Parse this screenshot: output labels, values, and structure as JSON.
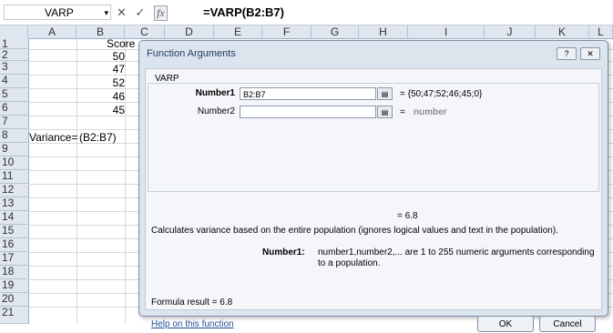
{
  "formula_bar": {
    "name_box": "VARP",
    "name_box_dropdown": "▾",
    "cancel_glyph": "✕",
    "enter_glyph": "✓",
    "fx_label": "fx",
    "formula": "=VARP(B2:B7)"
  },
  "columns": [
    "A",
    "B",
    "C",
    "D",
    "E",
    "F",
    "G",
    "H",
    "I",
    "J",
    "K",
    "L"
  ],
  "rows": [
    "1",
    "2",
    "3",
    "4",
    "5",
    "6",
    "7",
    "8",
    "9",
    "10",
    "11",
    "12",
    "13",
    "14",
    "15",
    "16",
    "17",
    "18",
    "19",
    "20",
    "21"
  ],
  "cells": {
    "B1": "Score",
    "B2": "50",
    "B3": "47",
    "B4": "52",
    "B5": "46",
    "B6": "45",
    "A8": "Variance=",
    "B8": "(B2:B7)"
  },
  "dialog": {
    "title": "Function Arguments",
    "help_glyph": "?",
    "close_glyph": "✕",
    "function_name": "VARP",
    "arg1_label": "Number1",
    "arg1_value": "B2:B7",
    "arg1_eval": "=  {50;47;52;46;45;0}",
    "arg2_label": "Number2",
    "arg2_value": "",
    "arg2_eval_eq": "=",
    "arg2_eval": "number",
    "ref_glyph": "▤",
    "function_result": "=  6.8",
    "description": "Calculates variance based on the entire population (ignores logical values and text in the population).",
    "arg_desc_name": "Number1:",
    "arg_desc_text": "number1,number2,... are 1 to 255 numeric arguments corresponding to a population.",
    "formula_result": "Formula result =  6.8",
    "help_link": "Help on this function",
    "ok_label": "OK",
    "cancel_label": "Cancel"
  }
}
